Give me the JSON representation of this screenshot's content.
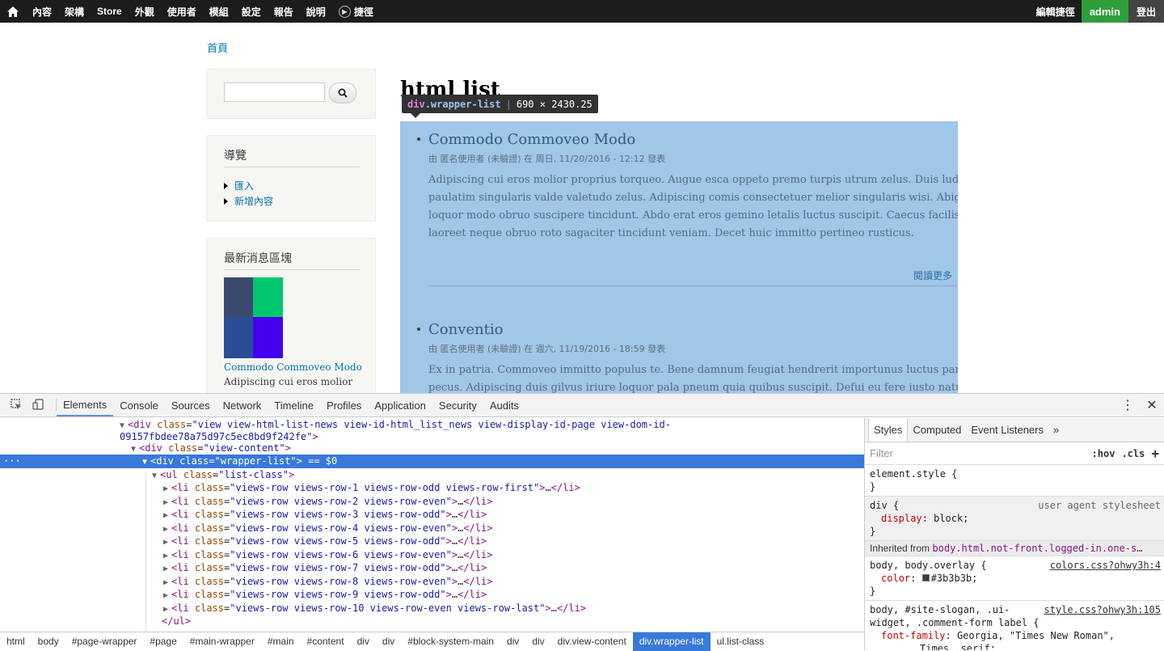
{
  "toolbar": {
    "items": [
      "內容",
      "架構",
      "Store",
      "外觀",
      "使用者",
      "模組",
      "設定",
      "報告",
      "說明"
    ],
    "shortcuts_label": "捷徑",
    "edit_shortcuts": "編輯捷徑",
    "user": "admin",
    "logout": "登出"
  },
  "breadcrumb": "首頁",
  "search": {
    "placeholder": ""
  },
  "nav_block": {
    "title": "導覽",
    "items": [
      "匯入",
      "新增內容"
    ]
  },
  "latest_block": {
    "title": "最新消息區塊",
    "link": "Commodo Commoveo Modo",
    "text": "Adipiscing cui eros molior",
    "thumb_colors": [
      "#3a4a6e",
      "#00c870",
      "#2a4e96",
      "#4400ee"
    ]
  },
  "main": {
    "title": "html list",
    "tooltip": {
      "tag": "div",
      "cls": ".wrapper-list",
      "size": "690 × 2430.25"
    },
    "items": [
      {
        "title": "Commodo Commoveo Modo",
        "meta": "由 匿名使用者 (未驗證) 在 周日, 11/20/2016 - 12:12 發表",
        "body": [
          "Adipiscing cui eros molior proprius torqueo. Augue esca oppeto premo turpis utrum zelus. Duis ludus",
          "paulatim singularis valde valetudo zelus. Adipiscing comis consectetuer melior singularis wisi. Abigo",
          "loquor modo obruo suscipere tincidunt. Abdo erat eros gemino letalis luctus suscipit. Caecus facilisis",
          "laoreet neque obruo roto sagaciter tincidunt veniam. Decet huic immitto pertineo rusticus."
        ],
        "read_more": "閱讀更多"
      },
      {
        "title": "Conventio",
        "meta": "由 匿名使用者 (未驗證) 在 週六, 11/19/2016 - 18:59 發表",
        "body": [
          "Ex in patria. Commoveo immitto populus te. Bene damnum feugiat hendrerit importunus luctus paratus",
          "pecus. Adipiscing duis gilvus iriure loquor pala pneum quia quibus suscipit. Defui eu fere iusto natu patria"
        ]
      }
    ]
  },
  "devtools": {
    "tabs": [
      "Elements",
      "Console",
      "Sources",
      "Network",
      "Timeline",
      "Profiles",
      "Application",
      "Security",
      "Audits"
    ],
    "dom": {
      "line1a": "view view-html-list-news view-id-html_list_news view-display-id-page view-dom-id-",
      "line1b": "09157fbdee78a75d97c5ec8bd9f242fe",
      "view_content": "view-content",
      "wrapper": "wrapper-list",
      "selected_suffix": " == $0",
      "ul_class": "list-class",
      "rows": [
        "views-row views-row-1 views-row-odd views-row-first",
        "views-row views-row-2 views-row-even",
        "views-row views-row-3 views-row-odd",
        "views-row views-row-4 views-row-even",
        "views-row views-row-5 views-row-odd",
        "views-row views-row-6 views-row-even",
        "views-row views-row-7 views-row-odd",
        "views-row views-row-8 views-row-even",
        "views-row views-row-9 views-row-odd",
        "views-row views-row-10 views-row-even views-row-last"
      ]
    },
    "breadcrumbs": [
      "html",
      "body",
      "#page-wrapper",
      "#page",
      "#main-wrapper",
      "#main",
      "#content",
      "div",
      "div",
      "#block-system-main",
      "div",
      "div",
      "div.view-content",
      "div.wrapper-list",
      "ul.list-class"
    ],
    "styles": {
      "tabs": [
        "Styles",
        "Computed",
        "Event Listeners"
      ],
      "filter": "Filter",
      "hov": ":hov",
      "cls": ".cls",
      "element_style": "element.style {",
      "div_selector": "div {",
      "div_source": "user agent stylesheet",
      "div_prop": "display",
      "div_val": "block;",
      "inherited_label": "Inherited from",
      "inherited_sel": "body.html.not-front.logged-in.one-s…",
      "body_selector": "body, body.overlay {",
      "body_source": "colors.css?ohwy3h:4",
      "body_prop": "color",
      "body_val": "#3b3b3b;",
      "font_selector_1": "body, #site-slogan, .ui-",
      "font_selector_2": "widget, .comment-form label {",
      "font_source": "style.css?ohwy3h:105",
      "font_prop": "font-family",
      "font_val_1": "Georgia, \"Times New Roman\",",
      "font_val_2": "Times, serif;"
    }
  }
}
